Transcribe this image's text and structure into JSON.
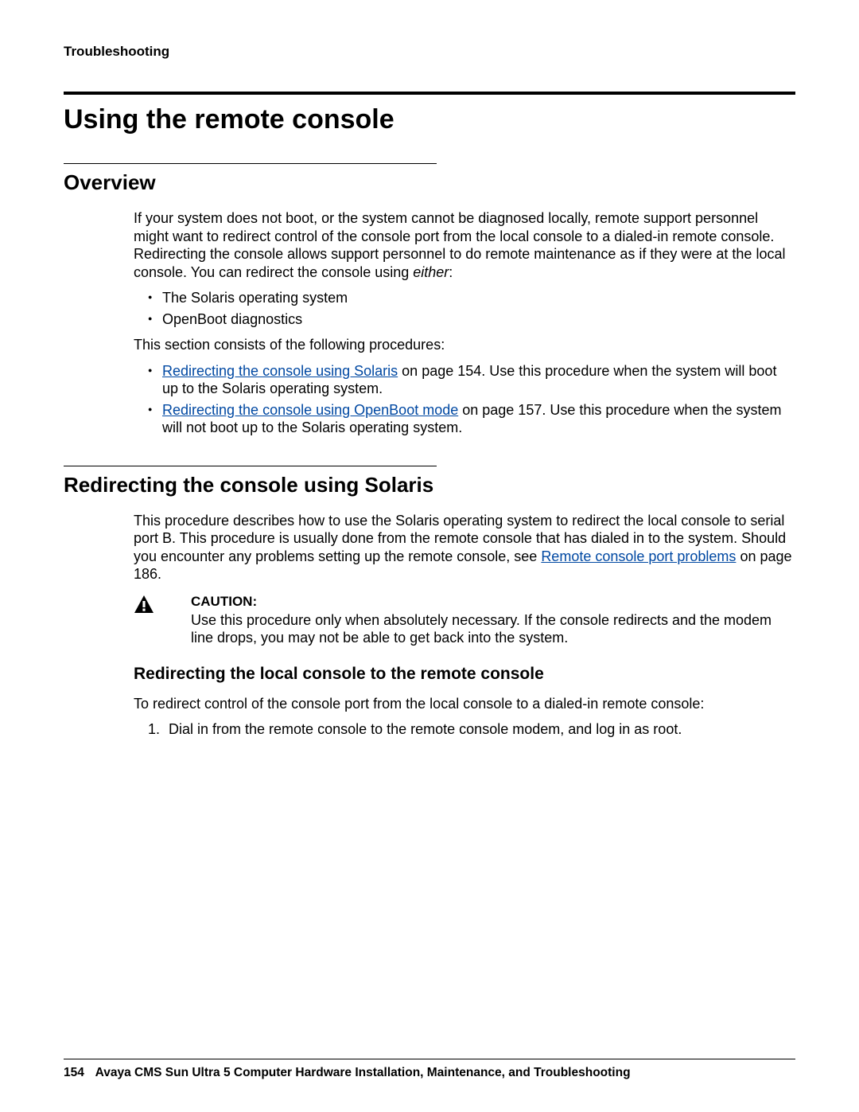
{
  "chapter": "Troubleshooting",
  "heading1": "Using the remote console",
  "overview": {
    "title": "Overview",
    "para_a": "If your system does not boot, or the system cannot be diagnosed locally, remote support personnel might want to redirect control of the console port from the local console to a dialed-in remote console. Redirecting the console allows support personnel to do remote maintenance as if they were at the local console. You can redirect the console using ",
    "para_a_italic": "either",
    "para_a_tail": ":",
    "bullets1": [
      "The Solaris operating system",
      "OpenBoot diagnostics"
    ],
    "procedures_lead": "This section consists of the following procedures:",
    "proc1_link": "Redirecting the console using Solaris",
    "proc1_tail": " on page 154. Use this procedure when the system will boot up to the Solaris operating system.",
    "proc2_link": "Redirecting the console using OpenBoot mode",
    "proc2_tail": " on page 157. Use this procedure when the system will not boot up to the Solaris operating system."
  },
  "solaris": {
    "title": "Redirecting the console using Solaris",
    "para_a": "This procedure describes how to use the Solaris operating system to redirect the local console to serial port B. This procedure is usually done from the remote console that has dialed in to the system. Should you encounter any problems setting up the remote console, see ",
    "para_a_link": "Remote console port problems",
    "para_a_tail": " on page 186.",
    "caution_label": "CAUTION:",
    "caution_text": "Use this procedure only when absolutely necessary. If the console redirects and the modem line drops, you may not be able to get back into the system.",
    "sub_title": "Redirecting the local console to the remote console",
    "sub_para": "To redirect control of the console port from the local console to a dialed-in remote console:",
    "step1": "Dial in from the remote console to the remote console modem, and log in as root."
  },
  "footer": {
    "page_number": "154",
    "doc_title": "Avaya CMS Sun Ultra 5 Computer Hardware Installation, Maintenance, and Troubleshooting"
  }
}
